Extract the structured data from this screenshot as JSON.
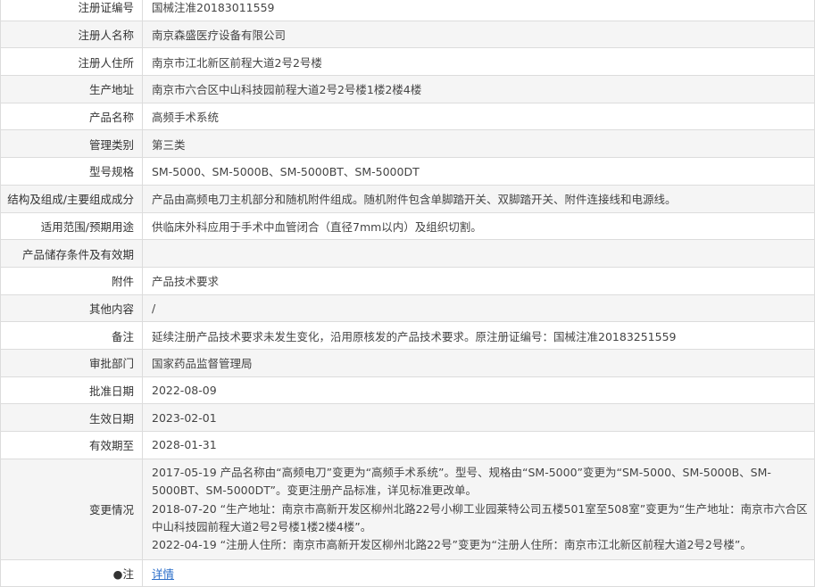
{
  "rows": [
    {
      "label": "注册证编号",
      "value": "国械注准20183011559"
    },
    {
      "label": "注册人名称",
      "value": "南京森盛医疗设备有限公司"
    },
    {
      "label": "注册人住所",
      "value": "南京市江北新区前程大道2号2号楼"
    },
    {
      "label": "生产地址",
      "value": "南京市六合区中山科技园前程大道2号2号楼1楼2楼4楼"
    },
    {
      "label": "产品名称",
      "value": "高频手术系统"
    },
    {
      "label": "管理类别",
      "value": "第三类"
    },
    {
      "label": "型号规格",
      "value": "SM-5000、SM-5000B、SM-5000BT、SM-5000DT"
    },
    {
      "label": "结构及组成/主要组成成分",
      "value": "产品由高频电刀主机部分和随机附件组成。随机附件包含单脚踏开关、双脚踏开关、附件连接线和电源线。"
    },
    {
      "label": "适用范围/预期用途",
      "value": "供临床外科应用于手术中血管闭合（直径7mm以内）及组织切割。"
    },
    {
      "label": "产品储存条件及有效期",
      "value": ""
    },
    {
      "label": "附件",
      "value": "产品技术要求"
    },
    {
      "label": "其他内容",
      "value": "/"
    },
    {
      "label": "备注",
      "value": "延续注册产品技术要求未发生变化，沿用原核发的产品技术要求。原注册证编号：国械注准20183251559"
    },
    {
      "label": "审批部门",
      "value": "国家药品监督管理局"
    },
    {
      "label": "批准日期",
      "value": "2022-08-09"
    },
    {
      "label": "生效日期",
      "value": "2023-02-01"
    },
    {
      "label": "有效期至",
      "value": "2028-01-31"
    }
  ],
  "changes": {
    "label": "变更情况",
    "lines": [
      "2017-05-19 产品名称由“高频电刀”变更为“高频手术系统”。型号、规格由“SM-5000”变更为“SM-5000、SM-5000B、SM-5000BT、SM-5000DT”。变更注册产品标准，详见标准更改单。",
      "2018-07-20 “生产地址：南京市高新开发区柳州北路22号小柳工业园莱特公司五楼501室至508室”变更为“生产地址：南京市六合区中山科技园前程大道2号2号楼1楼2楼4楼”。",
      "2022-04-19 “注册人住所：南京市高新开发区柳州北路22号”变更为“注册人住所：南京市江北新区前程大道2号2号楼”。"
    ]
  },
  "note_row": {
    "label": "●注",
    "link": "详情"
  }
}
